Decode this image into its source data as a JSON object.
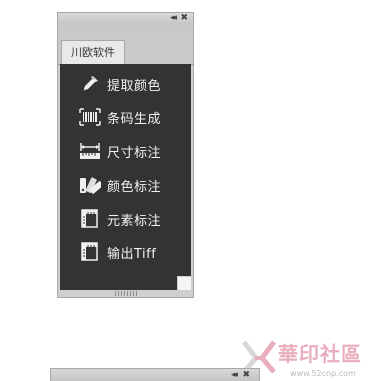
{
  "panel": {
    "titlebar": {
      "collapse_glyph": "◂◂",
      "close_glyph": "✖"
    },
    "tab_label": "川欧软件",
    "menu": [
      {
        "label": "提取颜色",
        "icon": "eyedropper-icon"
      },
      {
        "label": "条码生成",
        "icon": "barcode-icon"
      },
      {
        "label": "尺寸标注",
        "icon": "ruler-icon"
      },
      {
        "label": "颜色标注",
        "icon": "color-swatches-icon"
      },
      {
        "label": "元素标注",
        "icon": "element-frame-icon"
      },
      {
        "label": "输出Tiff",
        "icon": "tiff-frame-icon"
      }
    ]
  },
  "panel2": {
    "collapse_glyph": "◂◂",
    "close_glyph": "✖"
  },
  "watermark": {
    "title": "華印社區",
    "url": "www.52cnp.com"
  },
  "colors": {
    "panel_bg": "#333333",
    "label": "#f2f2f2",
    "watermark": "#e9aebd"
  }
}
